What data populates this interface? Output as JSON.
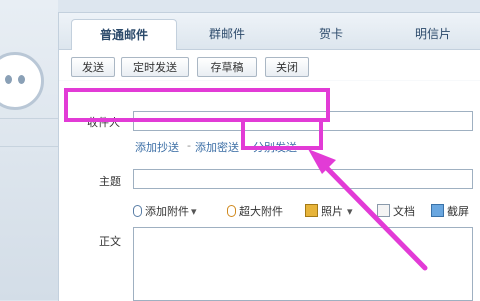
{
  "tabs": [
    {
      "label": "普通邮件",
      "active": true
    },
    {
      "label": "群邮件",
      "active": false
    },
    {
      "label": "贺卡",
      "active": false
    },
    {
      "label": "明信片",
      "active": false
    }
  ],
  "toolbar": {
    "send": "发送",
    "scheduled_send": "定时发送",
    "save_draft": "存草稿",
    "close": "关闭"
  },
  "form": {
    "recipient_label": "收件人",
    "recipient_value": "",
    "links": {
      "add_cc": "添加抄送",
      "separator": "-",
      "add_bcc": "添加密送",
      "split_send": "分别发送"
    },
    "subject_label": "主题",
    "subject_value": "",
    "attachments": {
      "add_attachment": "添加附件",
      "large_attachment": "超大附件",
      "photo": "照片",
      "document": "文档",
      "screenshot": "截屏"
    },
    "body_label": "正文"
  },
  "colors": {
    "highlight": "#e23bd6",
    "tab_text": "#2c4a6b",
    "link": "#3b6ea5"
  }
}
